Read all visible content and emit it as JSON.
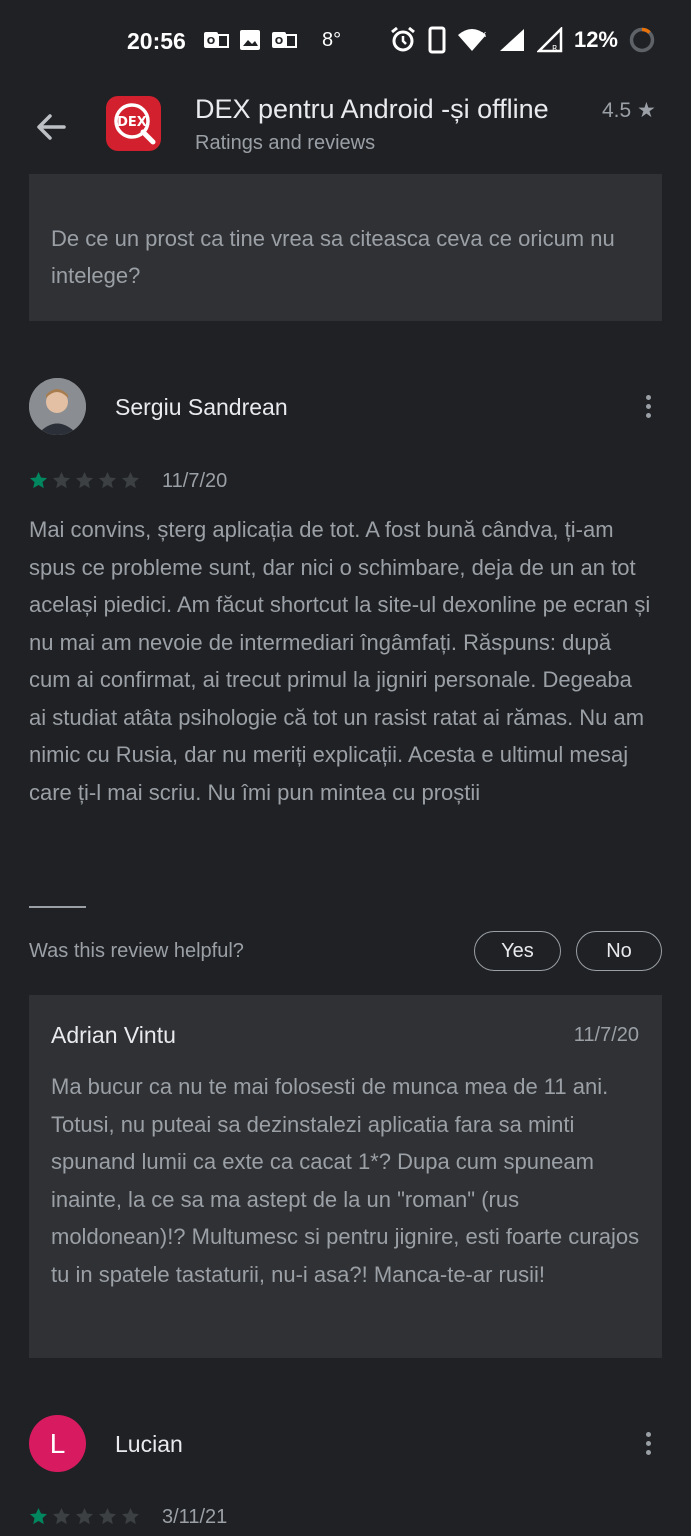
{
  "status_bar": {
    "time": "20:56",
    "temperature": "8°",
    "battery": "12%"
  },
  "app_bar": {
    "app_name": "DEX pentru Android -și offline",
    "rating": "4.5 ★",
    "subtitle": "Ratings and reviews",
    "icon_text": "DEX"
  },
  "previous_reply": {
    "text": "De ce un prost ca tine vrea sa citeasca ceva ce oricum nu intelege?"
  },
  "review": {
    "author": "Sergiu Sandrean",
    "stars": 1,
    "date": "11/7/20",
    "text": "Mai convins, șterg aplicația de tot. A fost bună cândva, ți-am spus ce probleme sunt, dar nici o schimbare, deja de un an tot același piedici. Am făcut shortcut la site-ul dexonline pe ecran și nu mai am nevoie de intermediari îngâmfați. Răspuns: după cum ai confirmat, ai trecut primul la jigniri personale. Degeaba ai studiat atâta psihologie că tot un rasist ratat ai rămas. Nu am nimic cu Rusia, dar nu meriți explicații. Acesta e ultimul mesaj care ți-l mai scriu. Nu îmi pun mintea cu proștii",
    "helpful_question": "Was this review helpful?",
    "yes_label": "Yes",
    "no_label": "No",
    "developer_reply": {
      "author": "Adrian Vintu",
      "date": "11/7/20",
      "text": "Ma bucur ca nu te mai folosesti de munca mea de 11 ani. Totusi, nu puteai sa dezinstalezi aplicatia fara sa minti spunand lumii ca exte ca cacat 1*? Dupa cum spuneam inainte, la ce sa ma astept de la un \"roman\" (rus moldonean)!? Multumesc si pentru jignire, esti foarte curajos tu in spatele tastaturii, nu-i asa?! Manca-te-ar rusii!"
    }
  },
  "next_review": {
    "author": "Lucian",
    "avatar_letter": "L",
    "stars": 1,
    "date": "3/11/21"
  },
  "colors": {
    "background": "#202124",
    "card": "#303134",
    "star_filled": "#01875f",
    "star_empty": "#3c4043",
    "avatar_l": "#d81b60",
    "app_icon": "#d3202f"
  }
}
